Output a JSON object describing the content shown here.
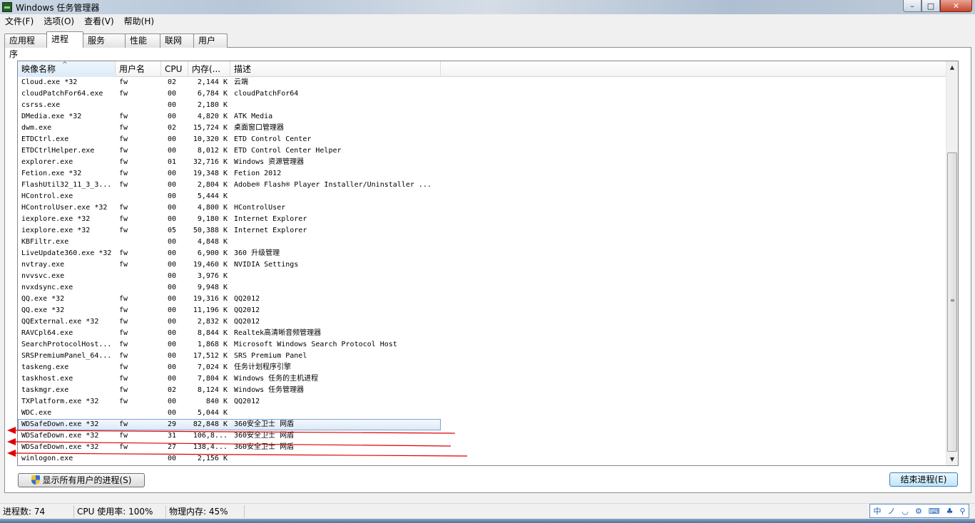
{
  "window": {
    "title": "Windows 任务管理器",
    "min": "–",
    "max": "□",
    "close": "✕"
  },
  "menu": [
    "文件(F)",
    "选项(O)",
    "查看(V)",
    "帮助(H)"
  ],
  "tabs": [
    "应用程序",
    "进程",
    "服务",
    "性能",
    "联网",
    "用户"
  ],
  "active_tab": "进程",
  "columns": [
    "映像名称",
    "用户名",
    "CPU",
    "内存(...",
    "描述"
  ],
  "sort_arrow": "^",
  "processes": [
    {
      "name": "Cloud.exe *32",
      "user": "fw",
      "cpu": "02",
      "mem": "2,144 K",
      "desc": "云端"
    },
    {
      "name": "cloudPatchFor64.exe",
      "user": "fw",
      "cpu": "00",
      "mem": "6,784 K",
      "desc": "cloudPatchFor64"
    },
    {
      "name": "csrss.exe",
      "user": "",
      "cpu": "00",
      "mem": "2,180 K",
      "desc": ""
    },
    {
      "name": "DMedia.exe *32",
      "user": "fw",
      "cpu": "00",
      "mem": "4,820 K",
      "desc": "ATK Media"
    },
    {
      "name": "dwm.exe",
      "user": "fw",
      "cpu": "02",
      "mem": "15,724 K",
      "desc": "桌面窗口管理器"
    },
    {
      "name": "ETDCtrl.exe",
      "user": "fw",
      "cpu": "00",
      "mem": "10,320 K",
      "desc": "ETD Control Center"
    },
    {
      "name": "ETDCtrlHelper.exe",
      "user": "fw",
      "cpu": "00",
      "mem": "8,012 K",
      "desc": "ETD Control Center Helper"
    },
    {
      "name": "explorer.exe",
      "user": "fw",
      "cpu": "01",
      "mem": "32,716 K",
      "desc": "Windows 资源管理器"
    },
    {
      "name": "Fetion.exe *32",
      "user": "fw",
      "cpu": "00",
      "mem": "19,348 K",
      "desc": "Fetion 2012"
    },
    {
      "name": "FlashUtil32_11_3_3...",
      "user": "fw",
      "cpu": "00",
      "mem": "2,804 K",
      "desc": "Adobe® Flash® Player Installer/Uninstaller ..."
    },
    {
      "name": "HControl.exe",
      "user": "",
      "cpu": "00",
      "mem": "5,444 K",
      "desc": ""
    },
    {
      "name": "HControlUser.exe *32",
      "user": "fw",
      "cpu": "00",
      "mem": "4,800 K",
      "desc": "HControlUser"
    },
    {
      "name": "iexplore.exe *32",
      "user": "fw",
      "cpu": "00",
      "mem": "9,180 K",
      "desc": "Internet Explorer"
    },
    {
      "name": "iexplore.exe *32",
      "user": "fw",
      "cpu": "05",
      "mem": "50,388 K",
      "desc": "Internet Explorer"
    },
    {
      "name": "KBFiltr.exe",
      "user": "",
      "cpu": "00",
      "mem": "4,848 K",
      "desc": ""
    },
    {
      "name": "LiveUpdate360.exe *32",
      "user": "fw",
      "cpu": "00",
      "mem": "6,900 K",
      "desc": "360 升级管理"
    },
    {
      "name": "nvtray.exe",
      "user": "fw",
      "cpu": "00",
      "mem": "19,460 K",
      "desc": "NVIDIA Settings"
    },
    {
      "name": "nvvsvc.exe",
      "user": "",
      "cpu": "00",
      "mem": "3,976 K",
      "desc": ""
    },
    {
      "name": "nvxdsync.exe",
      "user": "",
      "cpu": "00",
      "mem": "9,948 K",
      "desc": ""
    },
    {
      "name": "QQ.exe *32",
      "user": "fw",
      "cpu": "00",
      "mem": "19,316 K",
      "desc": "QQ2012"
    },
    {
      "name": "QQ.exe *32",
      "user": "fw",
      "cpu": "00",
      "mem": "11,196 K",
      "desc": "QQ2012"
    },
    {
      "name": "QQExternal.exe *32",
      "user": "fw",
      "cpu": "00",
      "mem": "2,832 K",
      "desc": "QQ2012"
    },
    {
      "name": "RAVCpl64.exe",
      "user": "fw",
      "cpu": "00",
      "mem": "8,844 K",
      "desc": "Realtek高清晰音频管理器"
    },
    {
      "name": "SearchProtocolHost...",
      "user": "fw",
      "cpu": "00",
      "mem": "1,868 K",
      "desc": "Microsoft Windows Search Protocol Host"
    },
    {
      "name": "SRSPremiumPanel_64...",
      "user": "fw",
      "cpu": "00",
      "mem": "17,512 K",
      "desc": "SRS Premium Panel"
    },
    {
      "name": "taskeng.exe",
      "user": "fw",
      "cpu": "00",
      "mem": "7,024 K",
      "desc": "任务计划程序引擎"
    },
    {
      "name": "taskhost.exe",
      "user": "fw",
      "cpu": "00",
      "mem": "7,804 K",
      "desc": "Windows 任务的主机进程"
    },
    {
      "name": "taskmgr.exe",
      "user": "fw",
      "cpu": "02",
      "mem": "8,124 K",
      "desc": "Windows 任务管理器"
    },
    {
      "name": "TXPlatform.exe *32",
      "user": "fw",
      "cpu": "00",
      "mem": "840 K",
      "desc": "QQ2012"
    },
    {
      "name": "WDC.exe",
      "user": "",
      "cpu": "00",
      "mem": "5,044 K",
      "desc": ""
    },
    {
      "name": "WDSafeDown.exe *32",
      "user": "fw",
      "cpu": "29",
      "mem": "82,848 K",
      "desc": "360安全卫士 网盾"
    },
    {
      "name": "WDSafeDown.exe *32",
      "user": "fw",
      "cpu": "31",
      "mem": "106,8...",
      "desc": "360安全卫士 网盾"
    },
    {
      "name": "WDSafeDown.exe *32",
      "user": "fw",
      "cpu": "27",
      "mem": "138,4...",
      "desc": "360安全卫士 网盾"
    },
    {
      "name": "winlogon.exe",
      "user": "",
      "cpu": "00",
      "mem": "2,156 K",
      "desc": ""
    }
  ],
  "selected_index": 30,
  "buttons": {
    "show_all": "显示所有用户的进程(S)",
    "end_process": "结束进程(E)"
  },
  "status": {
    "process_count": "进程数: 74",
    "cpu_usage": "CPU 使用率: 100%",
    "physical_memory": "物理内存: 45%"
  },
  "ime": [
    "中",
    "ノ",
    "◡",
    "⚙",
    "⌨",
    "♣",
    "⚲"
  ],
  "colors": {
    "annotation": "#e00000",
    "selection_border": "#7da2ce"
  }
}
